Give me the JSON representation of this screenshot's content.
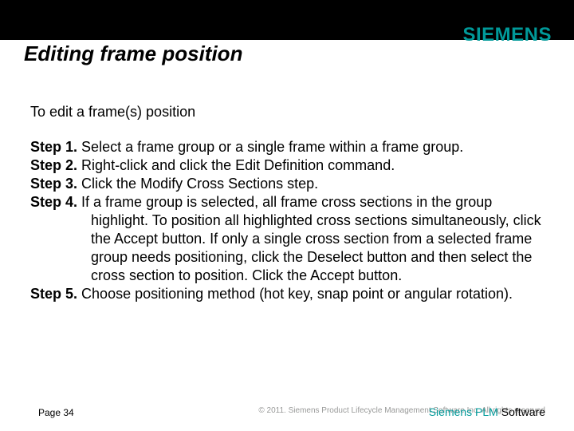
{
  "logo": "SIEMENS",
  "title": "Editing frame position",
  "intro": "To edit a frame(s) position",
  "steps": [
    {
      "label": "Step 1.",
      "text": "Select a frame group or a single frame within a frame group."
    },
    {
      "label": "Step 2.",
      "text": "Right-click and click the Edit Definition command."
    },
    {
      "label": "Step 3.",
      "text": "Click the Modify Cross Sections step."
    },
    {
      "label": "Step 4.",
      "text": "If a frame group is selected, all frame cross sections in the group highlight. To position all highlighted cross sections simultaneously, click the Accept button. If only a single cross section from a selected frame group needs positioning, click the Deselect button and then select the cross section to position. Click the Accept button."
    },
    {
      "label": "Step 5.",
      "text": "Choose positioning method (hot key, snap point or angular rotation)."
    }
  ],
  "footer": {
    "copyright": "© 2011. Siemens Product Lifecycle Management Software Inc. All rights reserved",
    "page": "Page 34",
    "brand_teal": "Siemens PLM ",
    "brand_black": "Software"
  }
}
